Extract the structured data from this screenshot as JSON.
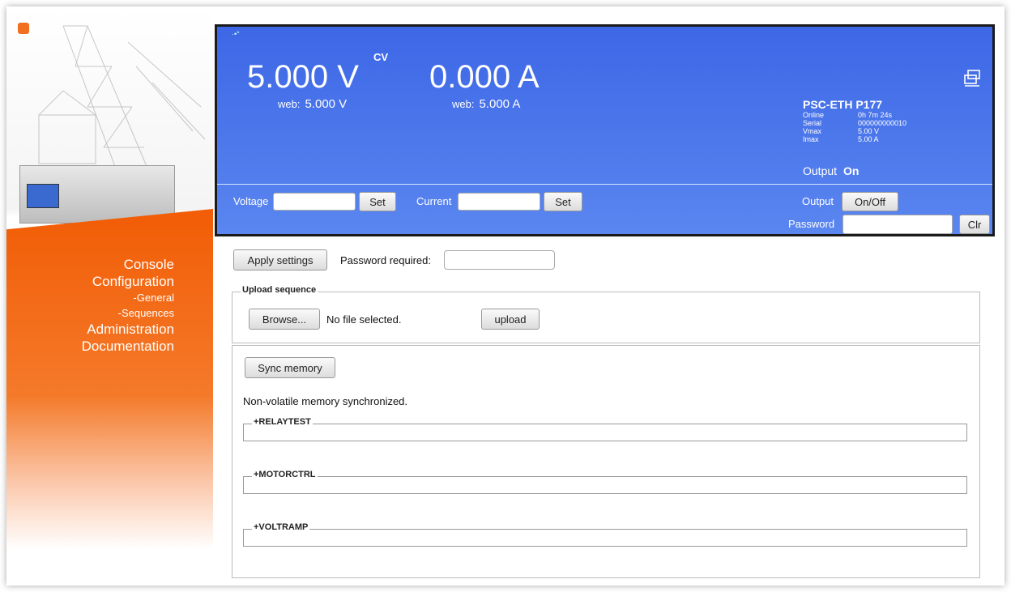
{
  "nav": {
    "console": "Console",
    "configuration": "Configuration",
    "general": "-General",
    "sequences": "-Sequences",
    "administration": "Administration",
    "documentation": "Documentation"
  },
  "display": {
    "voltage_reading": "5.000 V",
    "mode": "CV",
    "current_reading": "0.000 A",
    "web_label": "web:",
    "web_voltage": "5.000 V",
    "web_current": "5.000 A",
    "model": "PSC-ETH P177",
    "info": [
      {
        "key": "Online",
        "value": "0h 7m 24s"
      },
      {
        "key": "Serial",
        "value": "000000000010"
      },
      {
        "key": "Vmax",
        "value": "5.00 V"
      },
      {
        "key": "Imax",
        "value": "5.00 A"
      }
    ],
    "output_label": "Output",
    "output_state": "On",
    "voltage_label": "Voltage",
    "current_label": "Current",
    "set_label": "Set",
    "onoff_label": "On/Off",
    "password_label": "Password",
    "clr_label": "Clr"
  },
  "settings": {
    "apply_label": "Apply settings",
    "password_required": "Password required:"
  },
  "upload": {
    "legend": "Upload sequence",
    "browse_label": "Browse...",
    "file_status": "No file selected.",
    "upload_label": "upload"
  },
  "memory": {
    "sync_label": "Sync memory",
    "status": "Non-volatile memory synchronized.",
    "sequences": [
      "+RELAYTEST",
      "+MOTORCTRL",
      "+VOLTRAMP"
    ]
  },
  "colors": {
    "panel_blue": "#4a76ec",
    "sidebar_orange": "#f25c05"
  }
}
